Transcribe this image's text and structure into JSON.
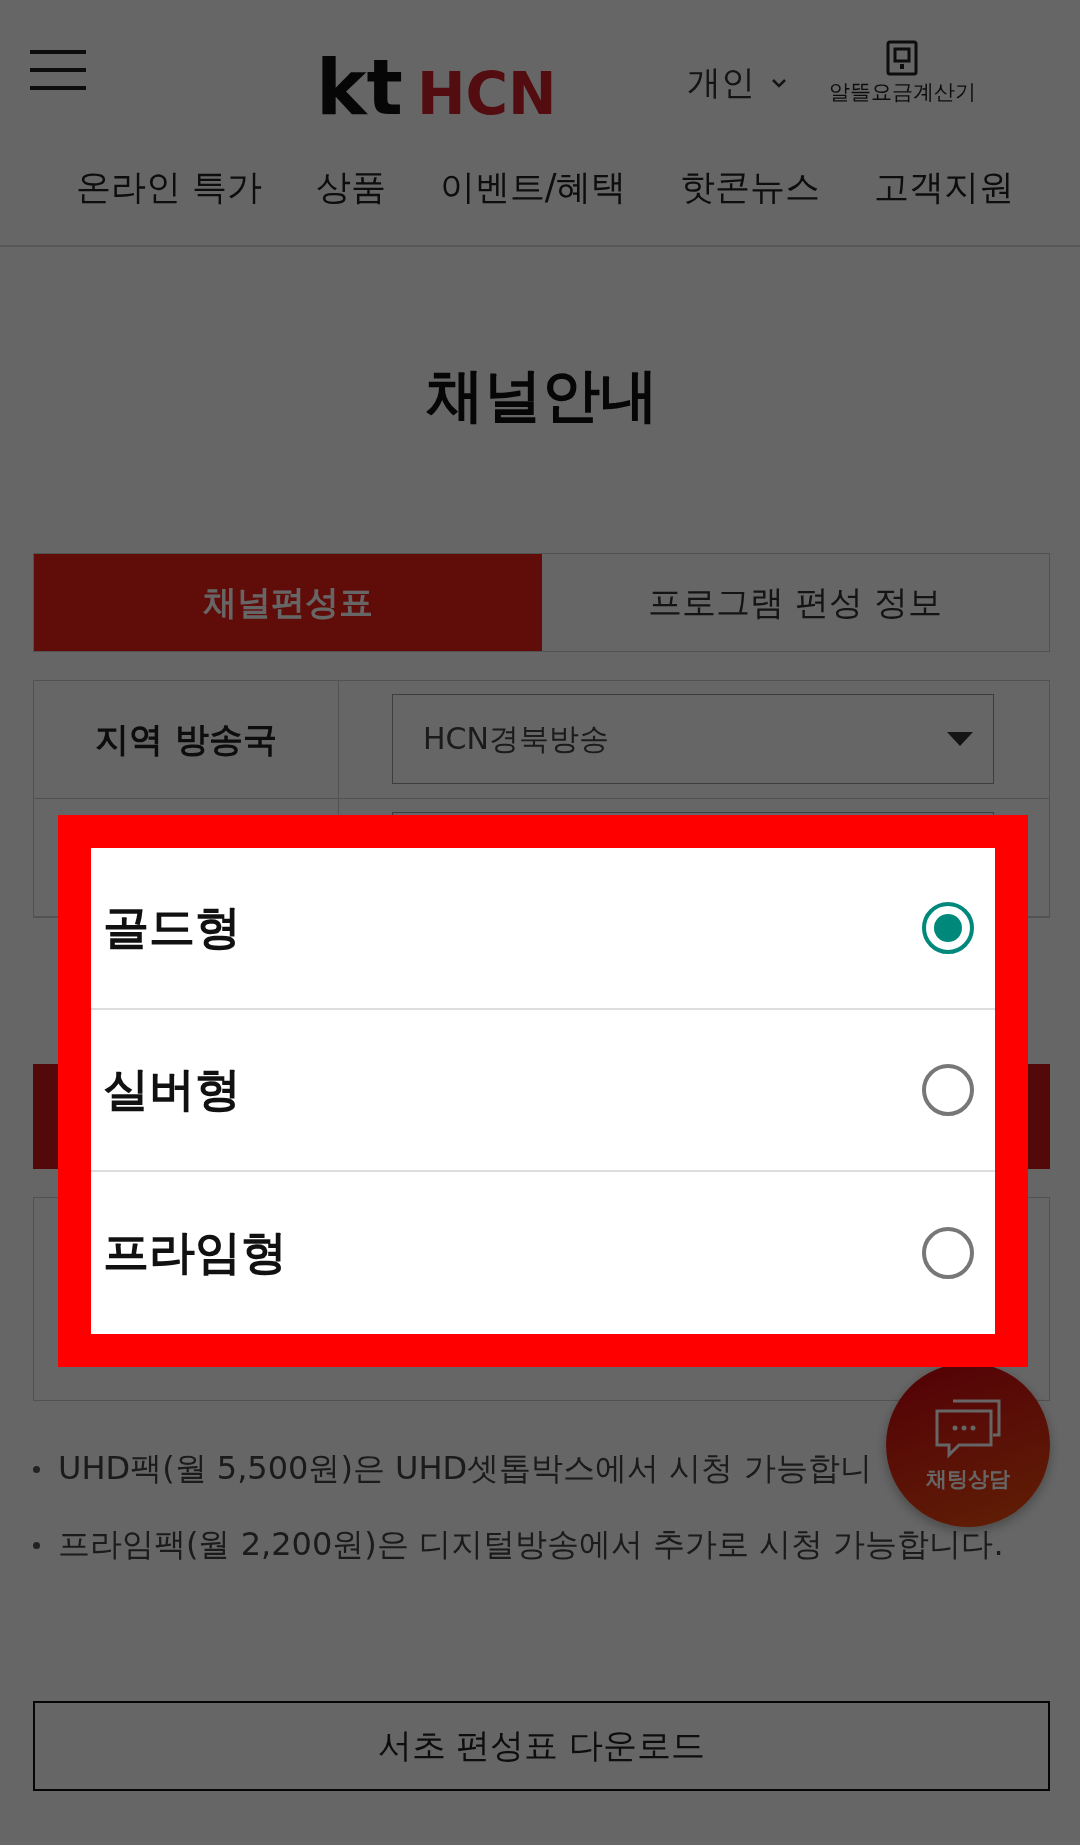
{
  "header": {
    "logo": {
      "mark": "kt",
      "name": "HCN"
    },
    "account_menu": "개인",
    "calculator_label": "알뜰요금계산기"
  },
  "nav": [
    "온라인 특가",
    "상품",
    "이벤트/혜택",
    "핫콘뉴스",
    "고객지원"
  ],
  "page_title": "채널안내",
  "tabs": [
    {
      "label": "채널편성표",
      "selected": true
    },
    {
      "label": "프로그램 편성 정보",
      "selected": false
    }
  ],
  "filters": [
    {
      "label": "지역 방송국",
      "value": "HCN경북방송"
    }
  ],
  "notes": [
    "UHD팩(월 5,500원)은 UHD셋톱박스에서 시청 가능합니",
    "프라임팩(월 2,200원)은 디지털방송에서 추가로 시청 가능합니다."
  ],
  "chat_button": {
    "label": "채팅상담"
  },
  "download_button": "서초 편성표 다운로드",
  "dialog": {
    "options": [
      {
        "label": "골드형",
        "selected": true
      },
      {
        "label": "실버형",
        "selected": false
      },
      {
        "label": "프라임형",
        "selected": false
      }
    ]
  }
}
